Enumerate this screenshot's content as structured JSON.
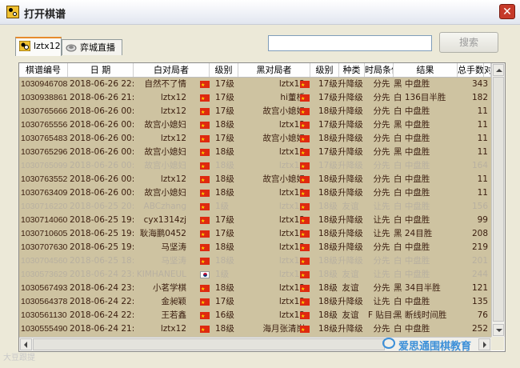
{
  "window": {
    "title": "打开棋谱",
    "close_label": "✕"
  },
  "tabs": [
    {
      "label": "lztx12",
      "icon": "user-icon",
      "active": true
    },
    {
      "label": "弈城直播",
      "icon": "broadcast-icon",
      "active": false
    }
  ],
  "search": {
    "value": "",
    "placeholder": "",
    "button_label": "搜索"
  },
  "table": {
    "columns": [
      "棋谱编号",
      "日 期",
      "白对局者",
      "级别",
      "黑对局者",
      "级别",
      "种类",
      "时局条件",
      "结果",
      "总手数",
      "对"
    ],
    "rows": [
      {
        "id": "1030946708",
        "date": "2018-06-26 22:29",
        "white": "自然不了情",
        "wflag": "cn",
        "wrank": "17级",
        "black": "lztx12",
        "bflag": "cn",
        "brank": "17级",
        "kind": "升降级",
        "rule": "分先",
        "result": "黑 中盘胜",
        "moves": "343",
        "dim": false
      },
      {
        "id": "1030938861",
        "date": "2018-06-26 21:52",
        "white": "lztx12",
        "wflag": "cn",
        "wrank": "17级",
        "black": "hi董桥",
        "bflag": "cn",
        "brank": "17级",
        "kind": "升降级",
        "rule": "分先",
        "result": "白 136目半胜",
        "moves": "182",
        "dim": false
      },
      {
        "id": "1030765666",
        "date": "2018-06-26 00:30",
        "white": "lztx12",
        "wflag": "cn",
        "wrank": "17级",
        "black": "故宫小媳妇",
        "bflag": "cn",
        "brank": "18级",
        "kind": "升降级",
        "rule": "分先",
        "result": "白 中盘胜",
        "moves": "11",
        "dim": false
      },
      {
        "id": "1030765556",
        "date": "2018-06-26 00:30",
        "white": "故宫小媳妇",
        "wflag": "cn",
        "wrank": "18级",
        "black": "lztx12",
        "bflag": "cn",
        "brank": "17级",
        "kind": "升降级",
        "rule": "分先",
        "result": "黑 中盘胜",
        "moves": "11",
        "dim": false
      },
      {
        "id": "1030765483",
        "date": "2018-06-26 00:28",
        "white": "lztx12",
        "wflag": "cn",
        "wrank": "17级",
        "black": "故宫小媳妇",
        "bflag": "cn",
        "brank": "18级",
        "kind": "升降级",
        "rule": "分先",
        "result": "白 中盘胜",
        "moves": "11",
        "dim": false
      },
      {
        "id": "1030765296",
        "date": "2018-06-26 00:27",
        "white": "故宫小媳妇",
        "wflag": "cn",
        "wrank": "18级",
        "black": "lztx12",
        "bflag": "cn",
        "brank": "17级",
        "kind": "升降级",
        "rule": "分先",
        "result": "黑 中盘胜",
        "moves": "11",
        "dim": false
      },
      {
        "id": "1030765099",
        "date": "2018-06-26 00:25",
        "white": "故宫小媳妇",
        "wflag": "cn",
        "wrank": "18级",
        "black": "lztx12",
        "bflag": "cn",
        "brank": "17级",
        "kind": "升降级",
        "rule": "分先",
        "result": "白 中盘胜",
        "moves": "164",
        "dim": true
      },
      {
        "id": "1030763552",
        "date": "2018-06-26 00:12",
        "white": "lztx12",
        "wflag": "cn",
        "wrank": "18级",
        "black": "故宫小媳妇",
        "bflag": "cn",
        "brank": "18级",
        "kind": "升降级",
        "rule": "分先",
        "result": "白 中盘胜",
        "moves": "11",
        "dim": false
      },
      {
        "id": "1030763409",
        "date": "2018-06-26 00:10",
        "white": "故宫小媳妇",
        "wflag": "cn",
        "wrank": "18级",
        "black": "lztx12",
        "bflag": "cn",
        "brank": "18级",
        "kind": "升降级",
        "rule": "分先",
        "result": "白 中盘胜",
        "moves": "11",
        "dim": false
      },
      {
        "id": "1030716220",
        "date": "2018-06-25 20:17",
        "white": "ABCzhang",
        "wflag": "cn",
        "wrank": "1级",
        "black": "lztx12",
        "bflag": "cn",
        "brank": "18级",
        "kind": "友谊",
        "rule": "让先",
        "result": "白 中盘胜",
        "moves": "156",
        "dim": true
      },
      {
        "id": "1030714060",
        "date": "2018-06-25 19:56",
        "white": "cyx1314zj",
        "wflag": "cn",
        "wrank": "17级",
        "black": "lztx12",
        "bflag": "cn",
        "brank": "18级",
        "kind": "升降级",
        "rule": "让先",
        "result": "白 中盘胜",
        "moves": "99",
        "dim": false
      },
      {
        "id": "1030710605",
        "date": "2018-06-25 19:34",
        "white": "耿海鹏0452",
        "wflag": "cn",
        "wrank": "17级",
        "black": "lztx12",
        "bflag": "cn",
        "brank": "18级",
        "kind": "升降级",
        "rule": "让先",
        "result": "黑 24目胜",
        "moves": "208",
        "dim": false
      },
      {
        "id": "1030707630",
        "date": "2018-06-25 19:19",
        "white": "马坚涛",
        "wflag": "cn",
        "wrank": "18级",
        "black": "lztx12",
        "bflag": "cn",
        "brank": "18级",
        "kind": "升降级",
        "rule": "分先",
        "result": "白 中盘胜",
        "moves": "219",
        "dim": false
      },
      {
        "id": "1030704560",
        "date": "2018-06-25 18:58",
        "white": "马坚涛",
        "wflag": "cn",
        "wrank": "18级",
        "black": "lztx12",
        "bflag": "cn",
        "brank": "18级",
        "kind": "升降级",
        "rule": "分先",
        "result": "白 中盘胜",
        "moves": "201",
        "dim": true
      },
      {
        "id": "1030573629",
        "date": "2018-06-24 23:51",
        "white": "KIMHANEUL",
        "wflag": "kr",
        "wrank": "1级",
        "black": "lztx12",
        "bflag": "cn",
        "brank": "18级",
        "kind": "友谊",
        "rule": "让先",
        "result": "白 中盘胜",
        "moves": "244",
        "dim": true
      },
      {
        "id": "1030567493",
        "date": "2018-06-24 23:08",
        "white": "小茗学棋",
        "wflag": "cn",
        "wrank": "18级",
        "black": "lztx12",
        "bflag": "cn",
        "brank": "18级",
        "kind": "友谊",
        "rule": "分先",
        "result": "黑 34目半胜",
        "moves": "121",
        "dim": false
      },
      {
        "id": "1030564378",
        "date": "2018-06-24 22:48",
        "white": "金昶颖",
        "wflag": "cn",
        "wrank": "17级",
        "black": "lztx12",
        "bflag": "cn",
        "brank": "18级",
        "kind": "升降级",
        "rule": "让先",
        "result": "白 中盘胜",
        "moves": "135",
        "dim": false
      },
      {
        "id": "1030561130",
        "date": "2018-06-24 22:27",
        "white": "王若鑫",
        "wflag": "cn",
        "wrank": "16级",
        "black": "lztx12",
        "bflag": "cn",
        "brank": "18级",
        "kind": "友谊",
        "rule": "F 贴目:",
        "result": "黑 断线时间胜",
        "moves": "76",
        "dim": false
      },
      {
        "id": "1030555490",
        "date": "2018-06-24 21:57",
        "white": "lztx12",
        "wflag": "cn",
        "wrank": "18级",
        "black": "海月张清岗",
        "bflag": "cn",
        "brank": "18级",
        "kind": "升降级",
        "rule": "分先",
        "result": "白 中盘胜",
        "moves": "252",
        "dim": false
      }
    ]
  },
  "watermark": {
    "left": "大豆跟提",
    "right": "爱思通围棋教育"
  },
  "colors": {
    "row_bg": "#cec3a1",
    "row_text": "#3a1d0e",
    "dim_text": "#b8b0a0",
    "close_btn": "#c63a2a"
  }
}
